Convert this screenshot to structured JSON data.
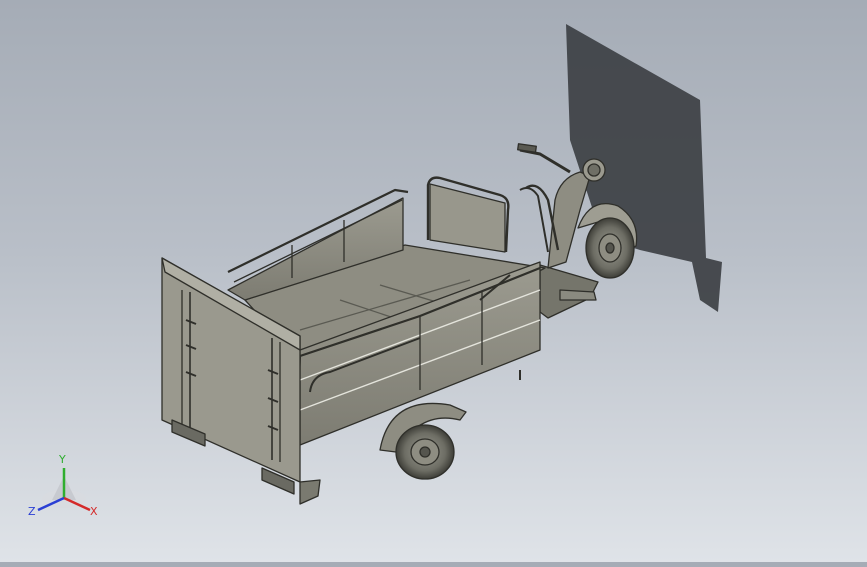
{
  "viewport": {
    "background_top": "#a5acb6",
    "background_bottom": "#dfe3e8",
    "model_color": "#8a8a80",
    "shadow_color": "#3d4044"
  },
  "triad": {
    "x_label": "X",
    "y_label": "Y",
    "z_label": "Z",
    "x_color": "#d42a2a",
    "y_color": "#2fae2f",
    "z_color": "#2a3fd4"
  }
}
